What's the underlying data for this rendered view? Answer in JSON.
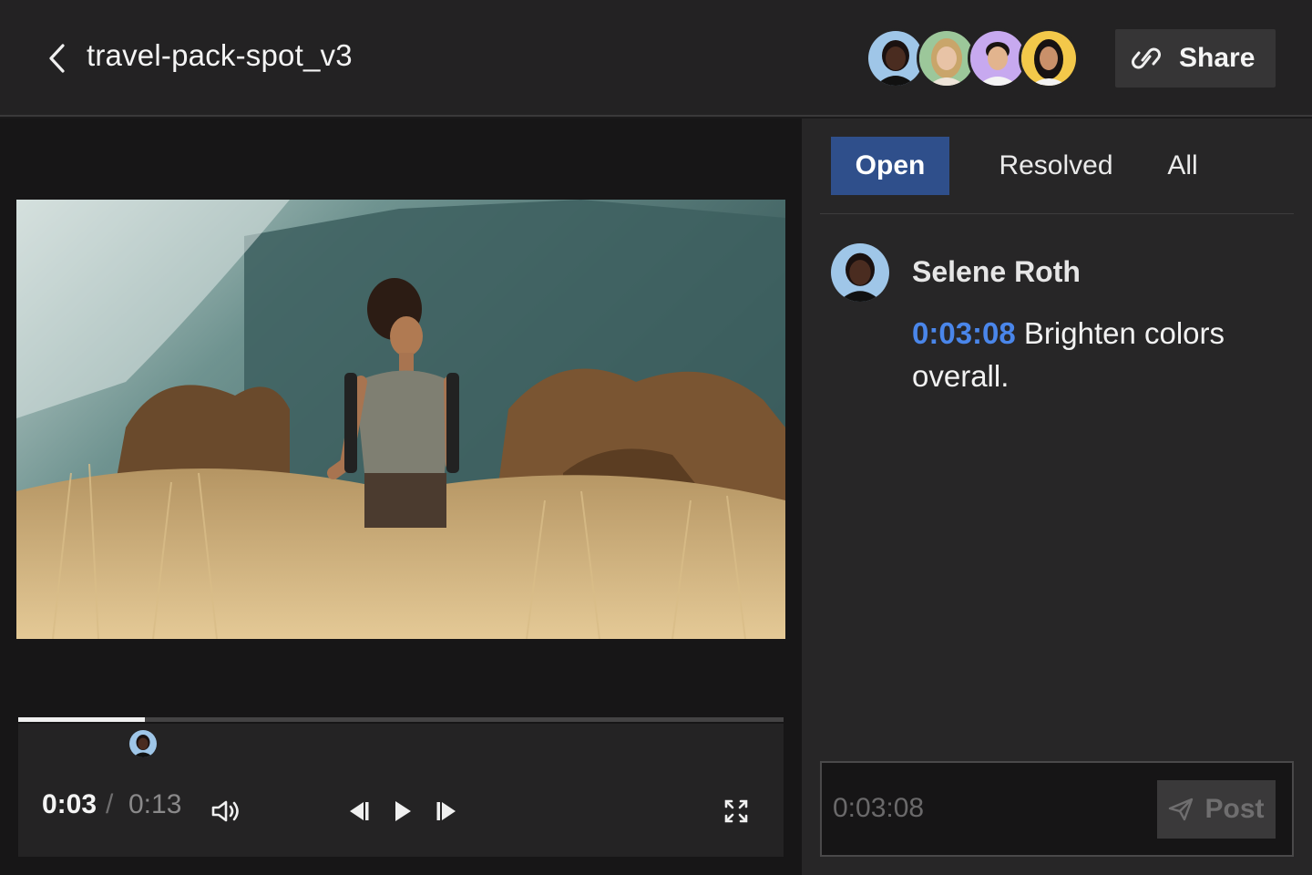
{
  "header": {
    "title": "travel-pack-spot_v3",
    "share_label": "Share",
    "collaborators": [
      {
        "name": "collaborator-1",
        "bg": "#9fc6e8",
        "skin": "#4a2c20",
        "hair": "#1a1110"
      },
      {
        "name": "collaborator-2",
        "bg": "#9cc79a",
        "skin": "#e8c3a6",
        "hair": "#c9a56a"
      },
      {
        "name": "collaborator-3",
        "bg": "#c7a9ef",
        "skin": "#e2b48e",
        "hair": "#1a1410"
      },
      {
        "name": "collaborator-4",
        "bg": "#f3c84a",
        "skin": "#c9906a",
        "hair": "#181212"
      }
    ]
  },
  "player": {
    "current_time": "0:03",
    "separator": "/",
    "total_time": "0:13",
    "progress": 0.165,
    "marker_position": 0.163
  },
  "comments": {
    "tabs": [
      {
        "label": "Open",
        "active": true
      },
      {
        "label": "Resolved",
        "active": false
      },
      {
        "label": "All",
        "active": false
      }
    ],
    "items": [
      {
        "author": "Selene Roth",
        "timestamp": "0:03:08",
        "text": "Brighten colors overall."
      }
    ],
    "input_placeholder": "0:03:08",
    "post_label": "Post"
  },
  "colors": {
    "accent_blue": "#2f4f8b",
    "timestamp_blue": "#4a86ea"
  },
  "icons": [
    "chevron-left-icon",
    "link-icon",
    "volume-icon",
    "step-back-icon",
    "play-icon",
    "step-forward-icon",
    "fullscreen-icon",
    "send-icon"
  ]
}
